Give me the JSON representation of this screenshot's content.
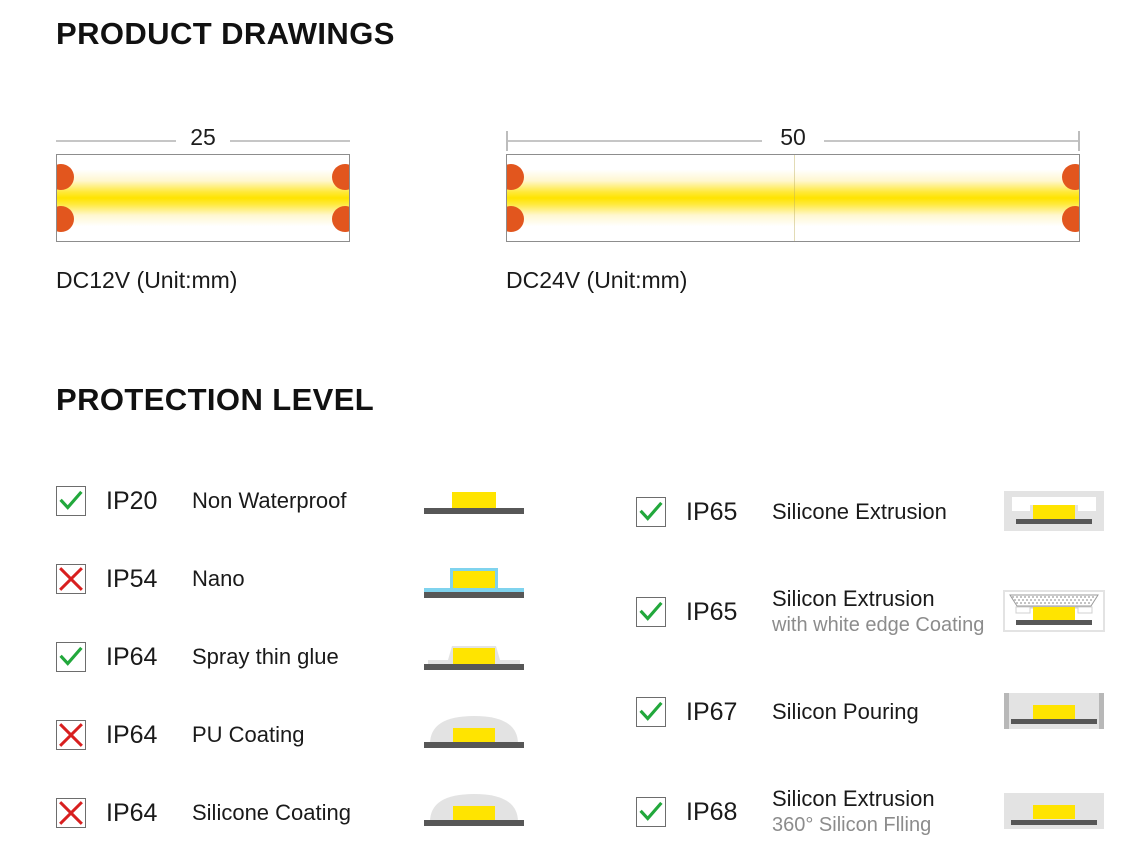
{
  "sections": {
    "drawings_title": "PRODUCT DRAWINGS",
    "protection_title": "PROTECTION LEVEL"
  },
  "drawings": [
    {
      "dimension": "25",
      "caption": "DC12V  (Unit:mm)",
      "end_ticks": false,
      "seam": false
    },
    {
      "dimension": "50",
      "caption": "DC24V  (Unit:mm)",
      "end_ticks": true,
      "seam": true
    }
  ],
  "protection_left": [
    {
      "status": "check",
      "code": "IP20",
      "main": "Non Waterproof",
      "sub": "",
      "figure": "flat-bare"
    },
    {
      "status": "cross",
      "code": "IP54",
      "main": "Nano",
      "sub": "",
      "figure": "nano-blue"
    },
    {
      "status": "check",
      "code": "IP64",
      "main": "Spray thin glue",
      "sub": "",
      "figure": "thin-glue"
    },
    {
      "status": "cross",
      "code": "IP64",
      "main": "PU Coating",
      "sub": "",
      "figure": "dome"
    },
    {
      "status": "cross",
      "code": "IP64",
      "main": "Silicone Coating",
      "sub": "",
      "figure": "dome"
    }
  ],
  "protection_right": [
    {
      "status": "check",
      "code": "IP65",
      "main": "Silicone Extrusion",
      "sub": "",
      "figure": "extrusion"
    },
    {
      "status": "check",
      "code": "IP65",
      "main": "Silicon Extrusion",
      "sub": "with white edge Coating",
      "figure": "extrusion-white-edge"
    },
    {
      "status": "check",
      "code": "IP67",
      "main": "Silicon Pouring",
      "sub": "",
      "figure": "pouring"
    },
    {
      "status": "check",
      "code": "IP68",
      "main": "Silicon Extrusion",
      "sub": "360° Silicon Flling",
      "figure": "filled"
    }
  ],
  "colors": {
    "led_yellow": "#ffe400",
    "pad_orange": "#e2561e",
    "check_green": "#22a83c",
    "cross_red": "#d81f1f",
    "sub_gray": "#8c8c8c",
    "pcb_gray": "#575757",
    "body_gray": "#e3e3e3",
    "nano_blue": "#7fd3ee"
  }
}
